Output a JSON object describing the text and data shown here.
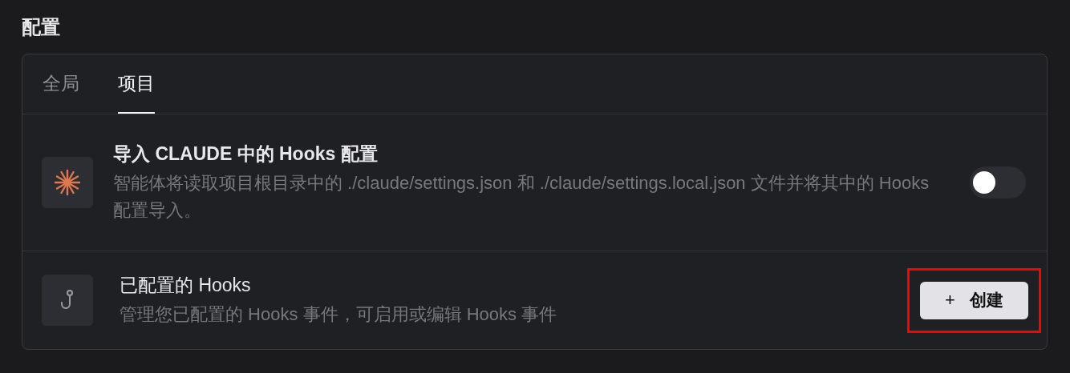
{
  "section_title": "配置",
  "tabs": [
    {
      "label": "全局",
      "selected": false
    },
    {
      "label": "项目",
      "selected": true
    }
  ],
  "rows": [
    {
      "kind": "toggle",
      "title": "导入 CLAUDE 中的 Hooks 配置",
      "description": "智能体将读取项目根目录中的 ./claude/settings.json 和 ./claude/settings.local.json 文件并将其中的 Hooks 配置导入。",
      "on": false
    },
    {
      "kind": "button",
      "title": "已配置的 Hooks",
      "description": "管理您已配置的 Hooks 事件，可启用或编辑 Hooks 事件",
      "button": {
        "icon": "+",
        "label": "创建",
        "highlighted": true
      }
    }
  ]
}
